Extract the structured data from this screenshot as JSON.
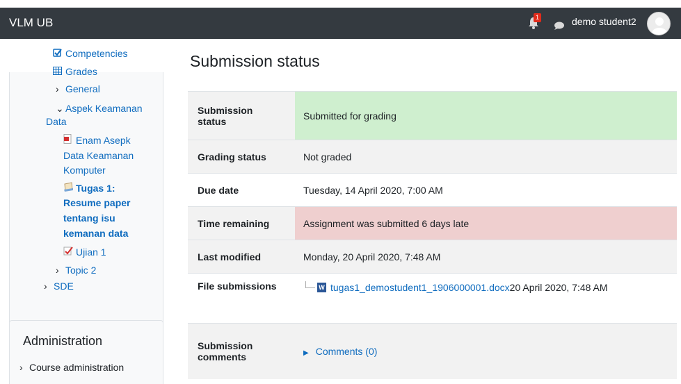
{
  "navbar": {
    "brand": "VLM UB",
    "notification_count": "1",
    "username": "demo student2"
  },
  "sidebar": {
    "items": [
      {
        "label": "Competencies",
        "icon": "checkbox-icon"
      },
      {
        "label": "Grades",
        "icon": "table-icon"
      },
      {
        "label": "General",
        "icon": "chevron-right-icon"
      },
      {
        "label_line1": "Aspek Keamanan",
        "label_line2": "Data",
        "icon": "chevron-down-icon"
      },
      {
        "label_line1": "Enam Asepk",
        "label_line2": "Data Keamanan",
        "label_line3": "Komputer",
        "icon": "pdf-icon"
      },
      {
        "label_line1": "Tugas 1:",
        "label_line2": "Resume paper",
        "label_line3": "tentang isu",
        "label_line4": "kemanan data",
        "icon": "assignment-icon"
      },
      {
        "label": "Ujian 1",
        "icon": "quiz-icon"
      },
      {
        "label": "Topic 2",
        "icon": "chevron-right-icon"
      },
      {
        "label": "SDE",
        "icon": "chevron-right-icon"
      }
    ],
    "admin_title": "Administration",
    "admin_item": "Course administration"
  },
  "main": {
    "title": "Submission status",
    "rows": [
      {
        "label_line1": "Submission",
        "label_line2": "status",
        "value": "Submitted for grading"
      },
      {
        "label": "Grading status",
        "value": "Not graded"
      },
      {
        "label": "Due date",
        "value": "Tuesday, 14 April 2020, 7:00 AM"
      },
      {
        "label": "Time remaining",
        "value": "Assignment was submitted 6 days late"
      },
      {
        "label": "Last modified",
        "value": "Monday, 20 April 2020, 7:48 AM"
      },
      {
        "label": "File submissions",
        "file_name": "tugas1_demostudent1_1906000001.docx",
        "file_date": "20 April 2020, 7:48 AM"
      },
      {
        "label_line1": "Submission",
        "label_line2": "comments",
        "value": "Comments (0)"
      }
    ]
  },
  "colors": {
    "navbar": "#343a40",
    "link": "#0f6cbf",
    "submitted_bg": "#cfefcf",
    "late_bg": "#efcfcf"
  }
}
